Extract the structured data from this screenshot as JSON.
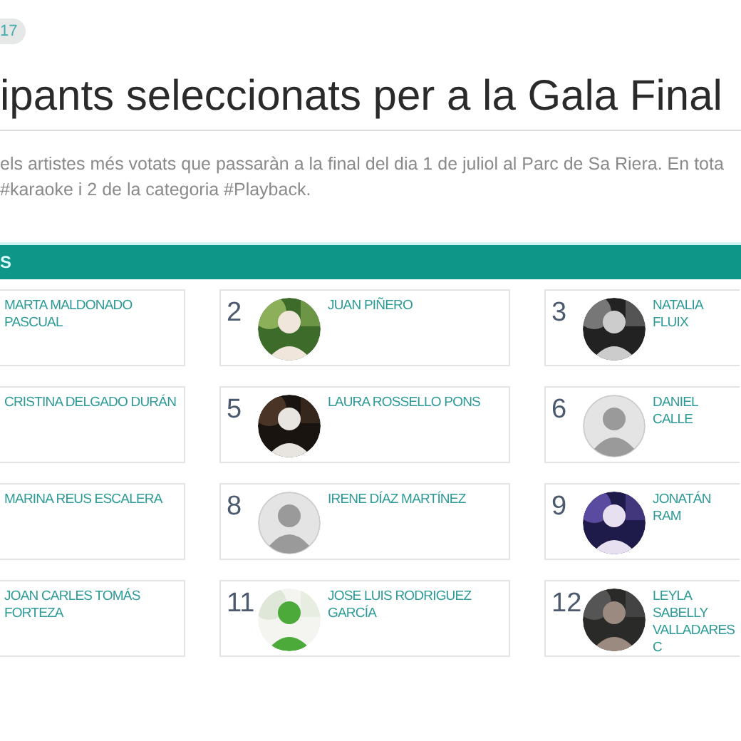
{
  "badge": "17",
  "title": "ipants seleccionats per a la Gala Final",
  "intro": [
    "els artistes més votats que passaràn a la final del dia 1 de juliol al Parc de Sa Riera. En tota",
    "#karaoke i 2 de la categoria #Playback."
  ],
  "section_bar": {
    "label": "S"
  },
  "rows": [
    [
      {
        "name": "MARTA MALDONADO PASCUAL"
      },
      {
        "number": "2",
        "name": "JUAN PIÑERO"
      },
      {
        "number": "3",
        "name": "NATALIA FLUIX"
      }
    ],
    [
      {
        "name": "CRISTINA DELGADO DURÁN"
      },
      {
        "number": "5",
        "name": "LAURA ROSSELLO PONS"
      },
      {
        "number": "6",
        "avatar": {
          "kind": "placeholder"
        },
        "name": "DANIEL CALLE"
      }
    ],
    [
      {
        "name": "MARINA REUS ESCALERA"
      },
      {
        "number": "8",
        "avatar": {
          "kind": "placeholder"
        },
        "name": "IRENE DÍAZ MARTÍNEZ"
      },
      {
        "number": "9",
        "name": "JONATÁN RAM"
      }
    ],
    [
      {
        "name": "JOAN CARLES TOMÁS FORTEZA"
      },
      {
        "number": "11",
        "name": "JOSE LUIS RODRIGUEZ GARCÍA"
      },
      {
        "number": "12",
        "name": "LEYLA SABELLY VALLADARES C"
      }
    ]
  ]
}
